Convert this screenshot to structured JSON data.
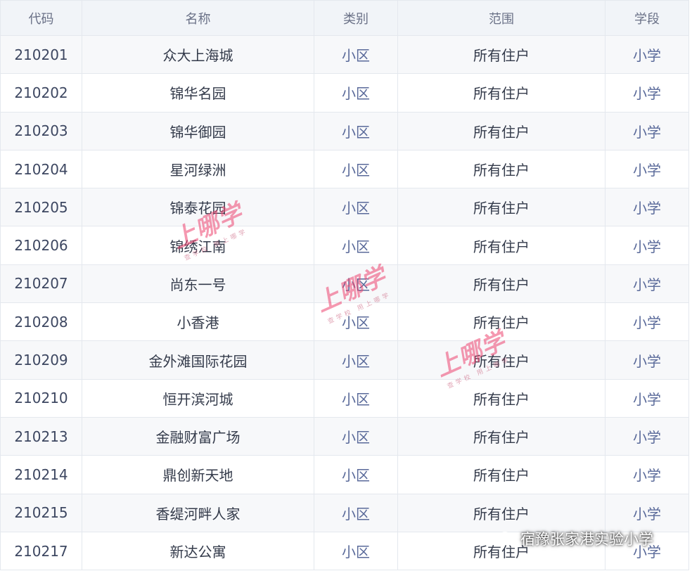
{
  "table": {
    "headers": {
      "code": "代码",
      "name": "名称",
      "type": "类别",
      "scope": "范围",
      "level": "学段"
    },
    "rows": [
      {
        "code": "210201",
        "name": "众大上海城",
        "type": "小区",
        "scope": "所有住户",
        "level": "小学"
      },
      {
        "code": "210202",
        "name": "锦华名园",
        "type": "小区",
        "scope": "所有住户",
        "level": "小学"
      },
      {
        "code": "210203",
        "name": "锦华御园",
        "type": "小区",
        "scope": "所有住户",
        "level": "小学"
      },
      {
        "code": "210204",
        "name": "星河绿洲",
        "type": "小区",
        "scope": "所有住户",
        "level": "小学"
      },
      {
        "code": "210205",
        "name": "锦泰花园",
        "type": "小区",
        "scope": "所有住户",
        "level": "小学"
      },
      {
        "code": "210206",
        "name": "锦绣江南",
        "type": "小区",
        "scope": "所有住户",
        "level": "小学"
      },
      {
        "code": "210207",
        "name": "尚东一号",
        "type": "小区",
        "scope": "所有住户",
        "level": "小学"
      },
      {
        "code": "210208",
        "name": "小香港",
        "type": "小区",
        "scope": "所有住户",
        "level": "小学"
      },
      {
        "code": "210209",
        "name": "金外滩国际花园",
        "type": "小区",
        "scope": "所有住户",
        "level": "小学"
      },
      {
        "code": "210210",
        "name": "恒开滨河城",
        "type": "小区",
        "scope": "所有住户",
        "level": "小学"
      },
      {
        "code": "210213",
        "name": "金融财富广场",
        "type": "小区",
        "scope": "所有住户",
        "level": "小学"
      },
      {
        "code": "210214",
        "name": "鼎创新天地",
        "type": "小区",
        "scope": "所有住户",
        "level": "小学"
      },
      {
        "code": "210215",
        "name": "香缇河畔人家",
        "type": "小区",
        "scope": "所有住户",
        "level": "小学"
      },
      {
        "code": "210217",
        "name": "新达公寓",
        "type": "小区",
        "scope": "所有住户",
        "level": "小学"
      }
    ]
  },
  "watermarks": [
    {
      "big": "上哪学",
      "small": "查学校 用上哪学"
    },
    {
      "big": "上哪学",
      "small": "查学校 用上哪学"
    },
    {
      "big": "上哪学",
      "small": "查学校 用上哪学"
    }
  ],
  "credit": {
    "icon": "wechat-icon",
    "text": "宿豫张家港实验小学"
  },
  "colors": {
    "header_bg": "#f1f4f8",
    "row_alt_bg": "#f7f8fa",
    "watermark": "#ec4470"
  }
}
